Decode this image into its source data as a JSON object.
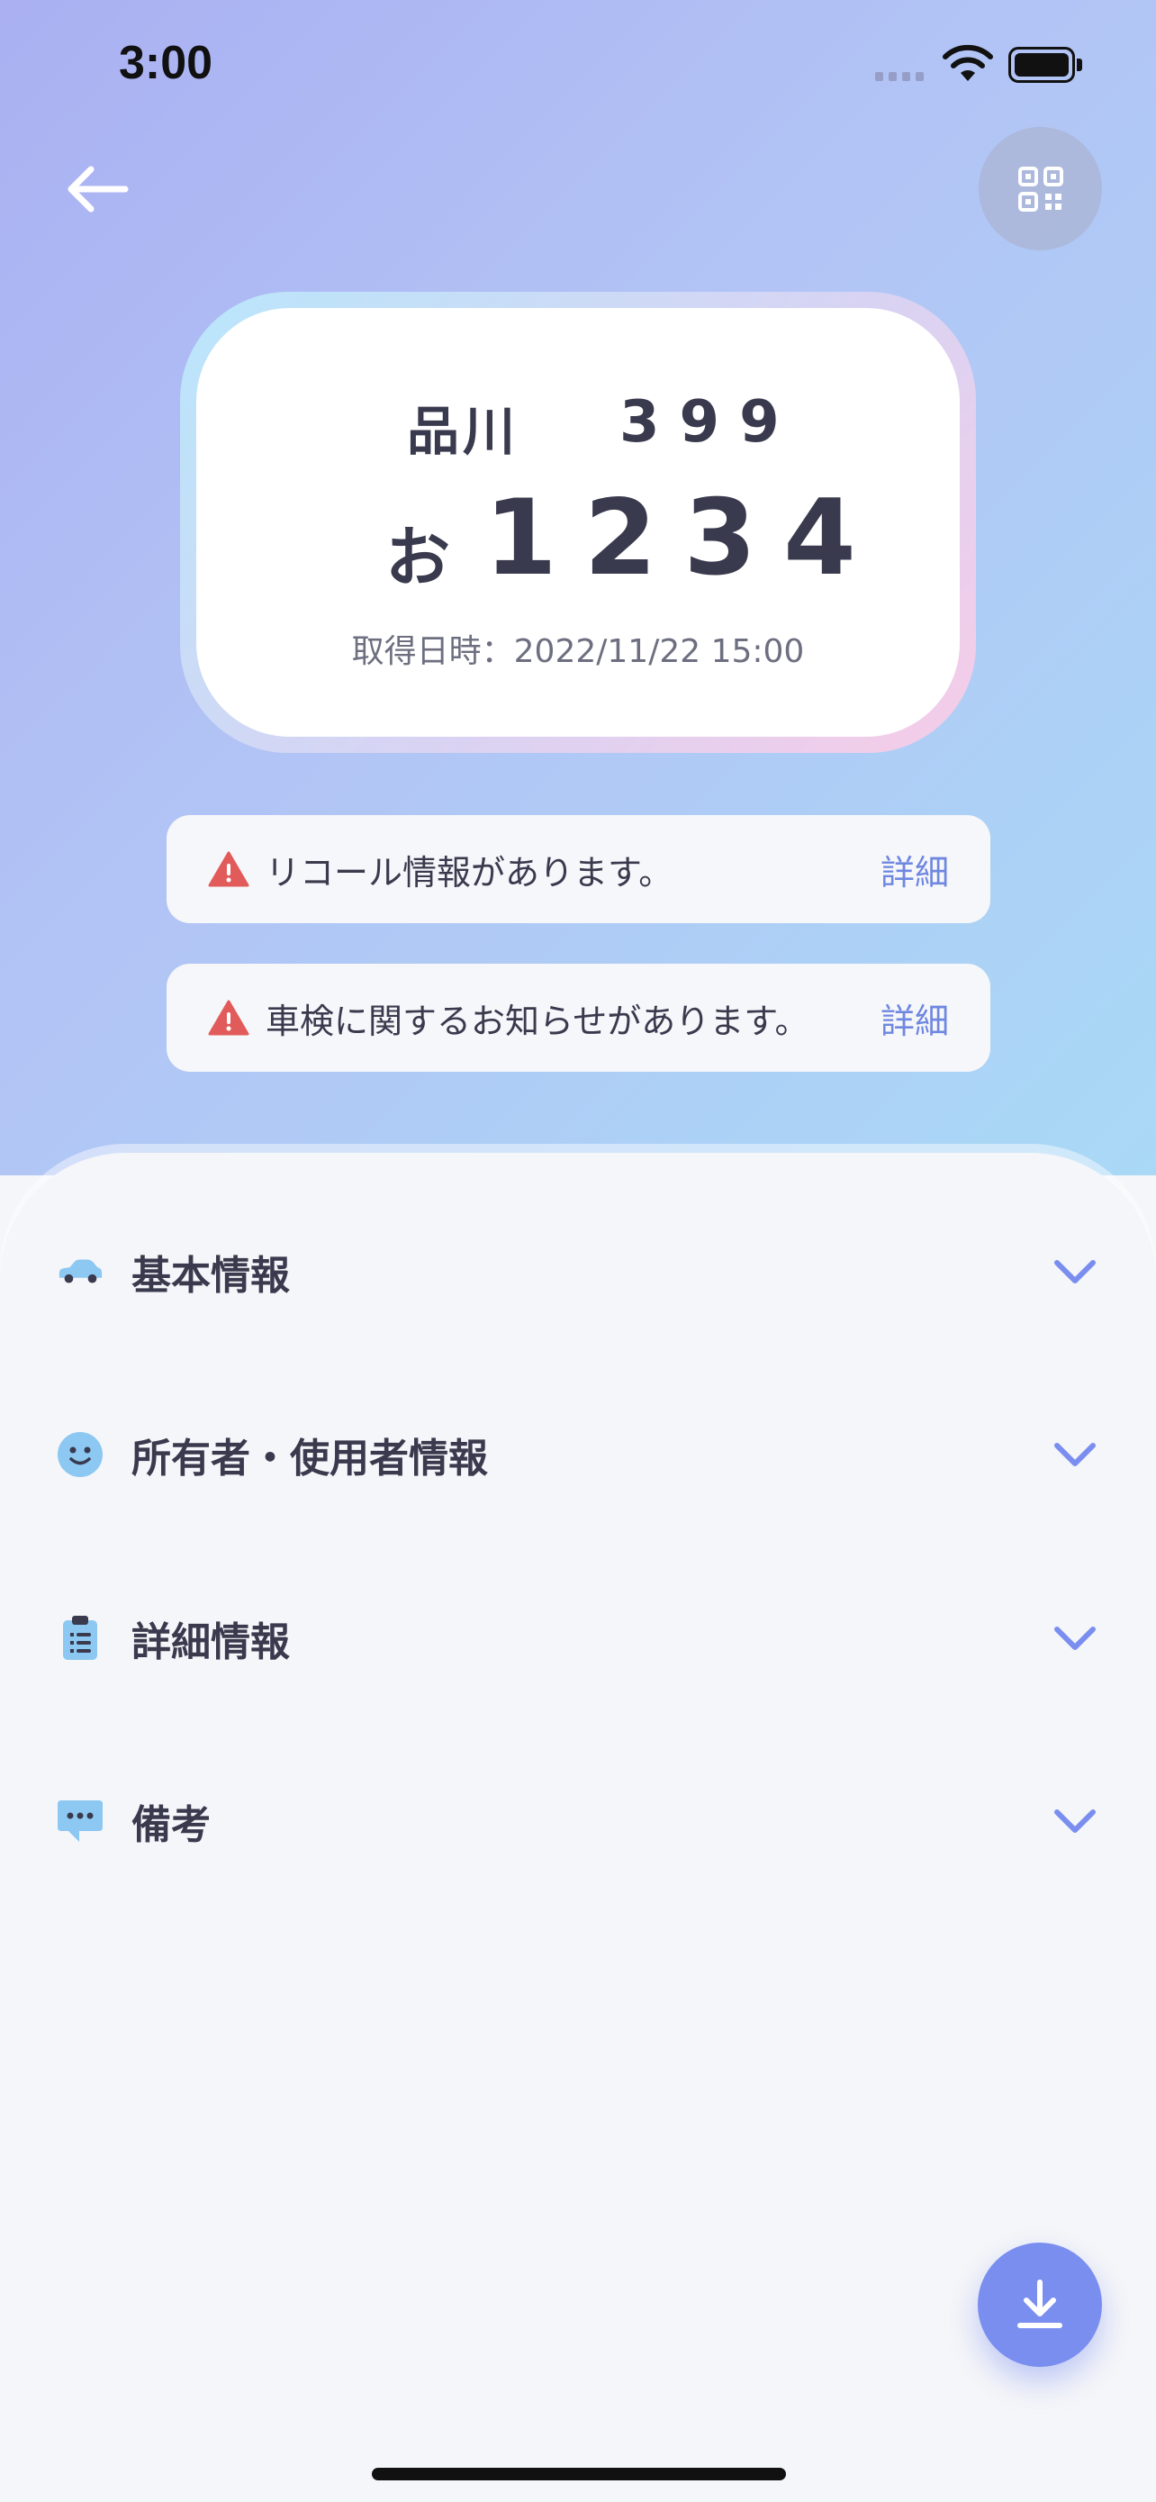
{
  "status_bar": {
    "time": "3:00"
  },
  "plate": {
    "region": "品川",
    "class_number": "399",
    "kana": "お",
    "number": "1234",
    "acquired_label": "取得日時：2022/11/22 15:00"
  },
  "alerts": [
    {
      "message": "リコール情報があります。",
      "link": "詳細"
    },
    {
      "message": "車検に関するお知らせがあります。",
      "link": "詳細"
    }
  ],
  "sections": [
    {
      "title": "基本情報",
      "icon": "car-icon"
    },
    {
      "title": "所有者・使用者情報",
      "icon": "smile-face-icon"
    },
    {
      "title": "詳細情報",
      "icon": "clipboard-icon"
    },
    {
      "title": "備考",
      "icon": "chat-bubble-icon"
    }
  ],
  "colors": {
    "accent": "#7a8ef0",
    "alert_red": "#e25b5b",
    "icon_blue": "#8cc8f2",
    "text": "#3a3a4e"
  }
}
